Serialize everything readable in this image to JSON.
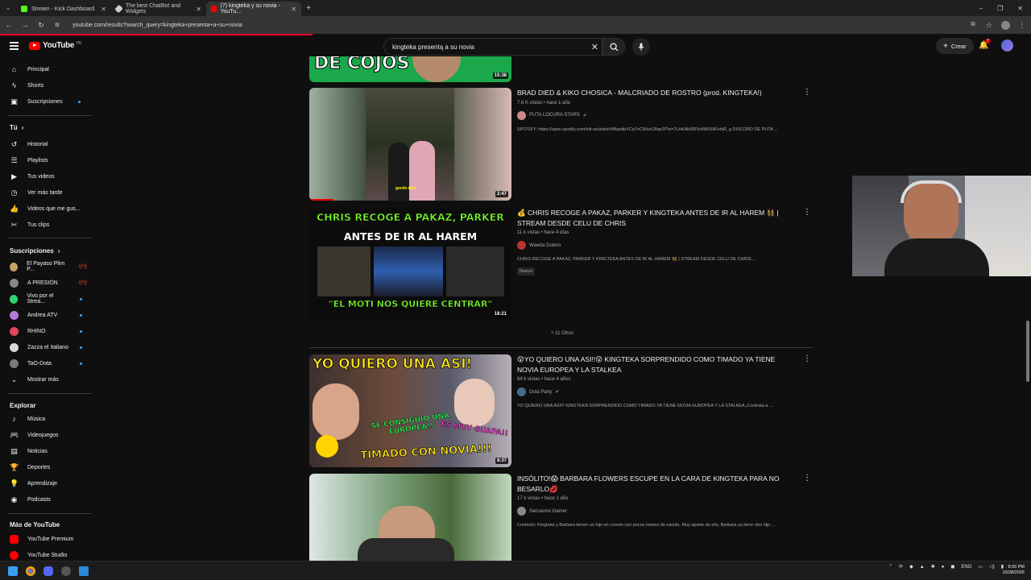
{
  "browser": {
    "tabs": [
      {
        "label": "Stream - Kick Dashboard",
        "active": false,
        "color": "#53fc18"
      },
      {
        "label": "The best ChatBot and Widgets",
        "active": false,
        "color": "#cccccc"
      },
      {
        "label": "(7) kingteka y su novia - YouTu...",
        "active": true,
        "color": "#ff0000"
      }
    ],
    "url": "youtube.com/results?search_query=kingteka+presenta+a+su+novia"
  },
  "header": {
    "logo_text": "YouTube",
    "country": "PE",
    "search_value": "kingteka presentą a su novia",
    "create_label": "Crear",
    "notif_count": "7"
  },
  "sidebar": {
    "main": [
      {
        "label": "Principal",
        "icon": "home-icon"
      },
      {
        "label": "Shorts",
        "icon": "shorts-icon"
      },
      {
        "label": "Suscripciones",
        "icon": "subscriptions-icon"
      }
    ],
    "you_heading": "Tú",
    "you": [
      {
        "label": "Historial",
        "icon": "history-icon"
      },
      {
        "label": "Playlists",
        "icon": "playlist-icon"
      },
      {
        "label": "Tus videos",
        "icon": "your-videos-icon"
      },
      {
        "label": "Ver más tarde",
        "icon": "watch-later-icon"
      },
      {
        "label": "Videos que me gus...",
        "icon": "like-icon"
      },
      {
        "label": "Tus clips",
        "icon": "clips-icon"
      }
    ],
    "subs_heading": "Suscripciones",
    "subs": [
      {
        "label": "El Payaso Plim P...",
        "color": "#c9a26b",
        "status": "live"
      },
      {
        "label": "A PRESIÓN",
        "color": "#888888",
        "status": "live"
      },
      {
        "label": "Vivo por el Strea...",
        "color": "#2fd46a",
        "status": "dot"
      },
      {
        "label": "Andrea ATV",
        "color": "#b57ad6",
        "status": "dot"
      },
      {
        "label": "RHINO",
        "color": "#e0475a",
        "status": "dot"
      },
      {
        "label": "Zazza el Italiano",
        "color": "#d8d8d8",
        "status": "dot"
      },
      {
        "label": "TaO-Dota",
        "color": "#7a7a7a",
        "status": "dot"
      }
    ],
    "show_more": "Mostrar más",
    "explore_heading": "Explorar",
    "explore": [
      {
        "label": "Música",
        "icon": "music-icon"
      },
      {
        "label": "Videojuegos",
        "icon": "gaming-icon"
      },
      {
        "label": "Noticias",
        "icon": "news-icon"
      },
      {
        "label": "Deportes",
        "icon": "trophy-icon"
      },
      {
        "label": "Aprendizaje",
        "icon": "learning-icon"
      },
      {
        "label": "Podcasts",
        "icon": "podcast-icon"
      }
    ],
    "more_heading": "Más de YouTube",
    "more": [
      {
        "label": "YouTube Premium",
        "color": "#ff0000"
      },
      {
        "label": "YouTube Studio",
        "color": "#ff0000"
      }
    ]
  },
  "results": {
    "top_partial": {
      "thumb_text": "DE COJOS",
      "duration": "15:38"
    },
    "videos": [
      {
        "title": "BRAD DIED & KIKO CHOSICA - MALCRIADO DE ROSTRO (prod. KINGTEKA!)",
        "meta": "7.6 K vistas • hace 1 año",
        "channel": "PUTA LOCURA STARS",
        "verified": true,
        "description": "SPOTIFY: https://open.spotify.com/intl-es/artist/4fAqwfpVCq7nCWsxG8qx2f?si=7LhKAkI9RSnW8S0iFehiR_g DISCORD DE PUTA ...",
        "duration": "2:47",
        "thumb_caption": "gordo dice",
        "badge": ""
      },
      {
        "title": "💰 CHRIS RECOGE A PAKAZ, PARKER Y KINGTEKA ANTES DE IR AL HAREM 👯 | STREAM DESDE CELU DE CHRIS",
        "meta": "11 k vistas • hace 4 días",
        "channel": "Wawita Dotero",
        "verified": false,
        "description": "CHRIS RECOGE A PAKAZ, PARKER Y KINGTEKA ANTES DE IR AL HAREM 👯 | STREAM DESDE CELU DE CHRIS ...",
        "duration": "18:21",
        "thumb_top": "CHRIS RECOGE A PAKAZ, PARKER",
        "thumb_mid": "ANTES DE IR AL HAREM",
        "thumb_bottom": "\"EL MOTI NOS QUIERE CENTRAR\"",
        "badge": "Nuevo"
      },
      {
        "title": "😲YO QUIERO UNA ASI!!😲 KINGTEKA SORPRENDIDO COMO TIMADO YA TIENE NOVIA EUROPEA Y LA STALKEA",
        "meta": "64 k vistas • hace 4 años",
        "channel": "Dota Party",
        "verified": true,
        "description": "YO QUIERO UNA ASI!!! KINGTEKA SORPRENDIDO COMO TIMADO YA TIENE NOVIA EUROPEA Y LA STALKEA ¡Contrata a ...",
        "duration": "8:37",
        "thumb_top": "YO QUIERO UNA ASI!",
        "thumb_mid1": "SE CONSIGUIO UNA EUROPEA!!",
        "thumb_mid2": "ES MUY GUAPA!!",
        "thumb_bottom": "TIMADO CON NOVIA!!!",
        "badge": ""
      },
      {
        "title": "INSÓLITO!😱 BARBARA FLOWERS ESCUPE EN LA CARA DE KINGTEKA PARA NO BESARLO💋",
        "meta": "17 k vistas • hace 1 año",
        "channel": "Sarcasmo Gamer",
        "verified": false,
        "description": "Contexto: Kingteka y Barbara tienen un hijo en común con pocos meses de nacido. Muy aparte de ello, Barbara ya tiene otro hijo ...",
        "duration": "",
        "badge": ""
      }
    ],
    "more_label": "+ 11 Otros"
  },
  "taskbar": {
    "lang": "ENG",
    "time": "8:05 PM",
    "date": "10/28/2025"
  }
}
